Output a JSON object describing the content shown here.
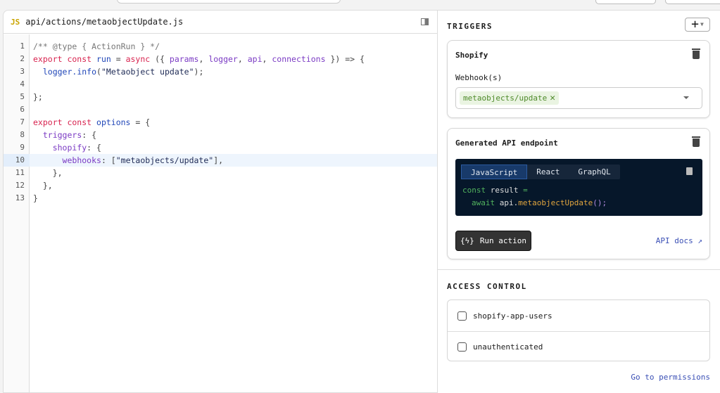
{
  "editor": {
    "file_icon": "JS",
    "file_path": "api/actions/metaobjectUpdate.js",
    "active_line": 10,
    "lines": [
      [
        [
          "cm",
          "/** @type { ActionRun } */"
        ]
      ],
      [
        [
          "kw",
          "export const "
        ],
        [
          "id",
          "run"
        ],
        [
          "pl",
          " = "
        ],
        [
          "kw",
          "async"
        ],
        [
          "pl",
          " ({ "
        ],
        [
          "pr",
          "params"
        ],
        [
          "pl",
          ", "
        ],
        [
          "pr",
          "logger"
        ],
        [
          "pl",
          ", "
        ],
        [
          "pr",
          "api"
        ],
        [
          "pl",
          ", "
        ],
        [
          "pr",
          "connections"
        ],
        [
          "pl",
          " }) => {"
        ]
      ],
      [
        [
          "pl",
          "  "
        ],
        [
          "id",
          "logger.info"
        ],
        [
          "pl",
          "("
        ],
        [
          "st",
          "\"Metaobject update\""
        ],
        [
          "pl",
          ");"
        ]
      ],
      [],
      [
        [
          "pl",
          "};"
        ]
      ],
      [],
      [
        [
          "kw",
          "export const "
        ],
        [
          "id",
          "options"
        ],
        [
          "pl",
          " = {"
        ]
      ],
      [
        [
          "pl",
          "  "
        ],
        [
          "pr",
          "triggers"
        ],
        [
          "pl",
          ": {"
        ]
      ],
      [
        [
          "pl",
          "    "
        ],
        [
          "pr",
          "shopify"
        ],
        [
          "pl",
          ": {"
        ]
      ],
      [
        [
          "pl",
          "      "
        ],
        [
          "pr",
          "webhooks"
        ],
        [
          "pl",
          ": ["
        ],
        [
          "st",
          "\"metaobjects/update\""
        ],
        [
          "pl",
          "],"
        ]
      ],
      [
        [
          "pl",
          "    },"
        ]
      ],
      [
        [
          "pl",
          "  },"
        ]
      ],
      [
        [
          "pl",
          "}"
        ]
      ]
    ]
  },
  "triggers": {
    "title": "TRIGGERS",
    "add_label": "+",
    "shopify": {
      "title": "Shopify",
      "webhooks_label": "Webhook(s)",
      "webhook_chip": "metaobjects/update",
      "chip_remove": "✕"
    },
    "endpoint": {
      "title": "Generated API endpoint",
      "tabs": [
        "JavaScript",
        "React",
        "GraphQL"
      ],
      "active_tab": "JavaScript",
      "code_l1_kw": "const",
      "code_l1_rest": " result ",
      "code_l1_eq": "=",
      "code_l2_kw": "await",
      "code_l2_obj": " api.",
      "code_l2_fn": "metaobjectUpdate",
      "code_l2_end": "();",
      "run_label": "Run action",
      "run_icon": "{ϟ}",
      "api_docs_label": "API docs"
    }
  },
  "access_control": {
    "title": "ACCESS CONTROL",
    "roles": [
      {
        "label": "shopify-app-users",
        "checked": false
      },
      {
        "label": "unauthenticated",
        "checked": false
      }
    ],
    "permissions_link": "Go to permissions"
  }
}
